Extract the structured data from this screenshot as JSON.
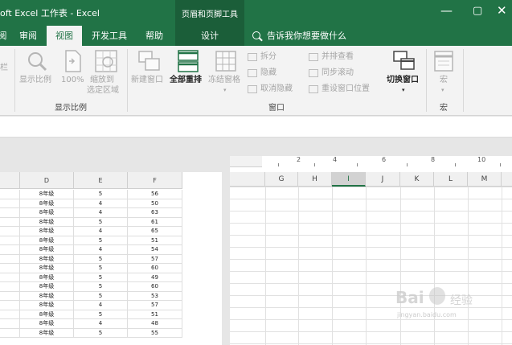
{
  "titlebar": {
    "title": "oft Excel 工作表  -  Excel",
    "context_tool_title": "页眉和页脚工具",
    "minimize_glyph": "—",
    "restore_glyph": "▢",
    "close_glyph": "✕"
  },
  "tabs": [
    {
      "label": "阅"
    },
    {
      "label": "审阅"
    },
    {
      "label": "视图"
    },
    {
      "label": "开发工具"
    },
    {
      "label": "帮助"
    },
    {
      "label": "设计"
    }
  ],
  "tell_me": "告诉我你想要做什么",
  "ribbon": {
    "partial_label": "栏",
    "zoom_group": {
      "zoom": "显示比例",
      "zoom100": "100%",
      "zoom_selection_line1": "缩放到",
      "zoom_selection_line2": "选定区域",
      "label": "显示比例"
    },
    "window_group": {
      "new_window": "新建窗口",
      "arrange_all": "全部重排",
      "freeze_panes": "冻结窗格",
      "split": "拆分",
      "hide": "隐藏",
      "unhide": "取消隐藏",
      "view_side_by_side": "并排查看",
      "sync_scroll": "同步滚动",
      "reset_position": "重设窗口位置",
      "switch_windows": "切换窗口",
      "label": "窗口"
    },
    "macro_group": {
      "macros": "宏",
      "label": "宏"
    }
  },
  "left_sheet": {
    "columns": [
      "D",
      "E",
      "F"
    ],
    "rows": [
      [
        "8年级",
        "5",
        "56"
      ],
      [
        "8年级",
        "4",
        "50"
      ],
      [
        "8年级",
        "4",
        "63"
      ],
      [
        "8年级",
        "5",
        "61"
      ],
      [
        "8年级",
        "4",
        "65"
      ],
      [
        "8年级",
        "5",
        "51"
      ],
      [
        "8年级",
        "4",
        "54"
      ],
      [
        "8年级",
        "5",
        "57"
      ],
      [
        "8年级",
        "5",
        "60"
      ],
      [
        "8年级",
        "5",
        "49"
      ],
      [
        "8年级",
        "5",
        "60"
      ],
      [
        "8年级",
        "5",
        "53"
      ],
      [
        "8年级",
        "4",
        "57"
      ],
      [
        "8年级",
        "5",
        "51"
      ],
      [
        "8年级",
        "4",
        "48"
      ],
      [
        "8年级",
        "5",
        "55"
      ]
    ]
  },
  "right_sheet": {
    "ruler_ticks": [
      "2",
      "4",
      "6",
      "8",
      "10",
      "12"
    ],
    "columns": [
      "G",
      "H",
      "I",
      "J",
      "K",
      "L",
      "M"
    ],
    "selected_column": "I"
  },
  "watermark": {
    "brand": "Bai",
    "suffix": "经验",
    "url": "jingyan.baidu.com"
  },
  "colors": {
    "brand_green": "#217346",
    "dark_green": "#1b5e39",
    "ribbon_bg": "#f3f3f3"
  }
}
